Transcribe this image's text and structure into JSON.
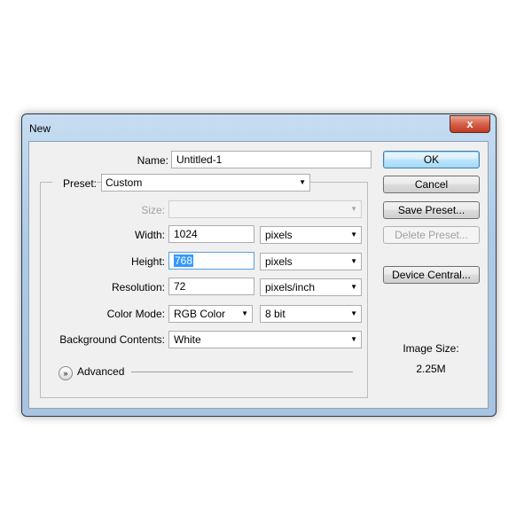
{
  "window": {
    "title": "New",
    "close_glyph": "x"
  },
  "form": {
    "name_label": "Name:",
    "name_value": "Untitled-1",
    "preset_label": "Preset:",
    "preset_value": "Custom",
    "size_label": "Size:",
    "size_value": "",
    "width_label": "Width:",
    "width_value": "1024",
    "width_unit": "pixels",
    "height_label": "Height:",
    "height_value": "768",
    "height_unit": "pixels",
    "resolution_label": "Resolution:",
    "resolution_value": "72",
    "resolution_unit": "pixels/inch",
    "color_mode_label": "Color Mode:",
    "color_mode_value": "RGB Color",
    "bit_depth_value": "8 bit",
    "background_label": "Background Contents:",
    "background_value": "White",
    "advanced_label": "Advanced"
  },
  "buttons": {
    "ok": "OK",
    "cancel": "Cancel",
    "save_preset": "Save Preset...",
    "delete_preset": "Delete Preset...",
    "device_central": "Device Central..."
  },
  "image_size": {
    "label": "Image Size:",
    "value": "2.25M"
  },
  "icons": {
    "dropdown": "chevron-down-icon",
    "advanced": "double-chevron-icon",
    "close": "close-icon"
  },
  "colors": {
    "selection": "#3399ff",
    "title_gradient": "#aecbe6",
    "close_red": "#c23c22"
  }
}
